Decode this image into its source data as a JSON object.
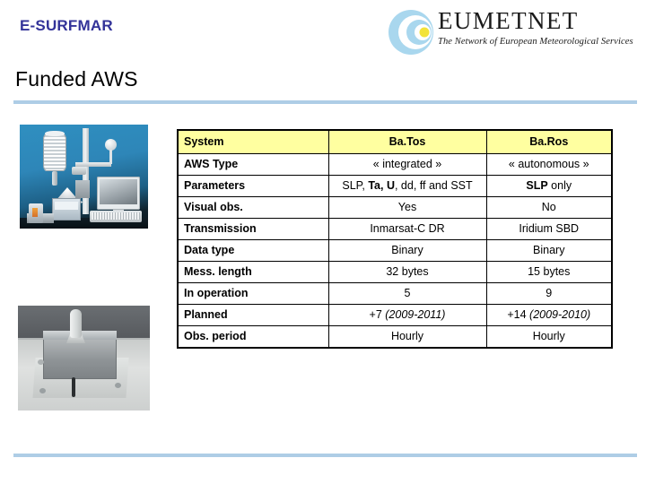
{
  "header": {
    "brand": "E-SURFMAR",
    "logo": {
      "word": "EUMETNET",
      "tagline": "The Network of European Meteorological Services",
      "mark": "eumetnet-circle-logo"
    }
  },
  "slide": {
    "title": "Funded AWS"
  },
  "photos": [
    {
      "name": "aws-station-photo",
      "caption": "BaTos integrated automatic weather station equipment"
    },
    {
      "name": "baros-unit-photo",
      "caption": "BaRos autonomous barometer unit mounted on deck"
    }
  ],
  "table": {
    "columns": [
      "System",
      "Ba.Tos",
      "Ba.Ros"
    ],
    "rows": [
      {
        "label": "AWS Type",
        "batos": "« integrated »",
        "baros": "« autonomous »"
      },
      {
        "label": "Parameters",
        "batos_line1_a": "SLP, ",
        "batos_line1_b": "Ta, U",
        "batos_line1_c": ", dd, ff",
        "batos_line2": "and SST",
        "baros_a": "SLP",
        "baros_b": " only"
      },
      {
        "label": "Visual obs.",
        "batos": "Yes",
        "baros": "No"
      },
      {
        "label": "Transmission",
        "batos": "Inmarsat-C DR",
        "baros": "Iridium SBD"
      },
      {
        "label": "Data type",
        "batos": "Binary",
        "baros": "Binary"
      },
      {
        "label": "Mess. length",
        "batos": "32 bytes",
        "baros": "15 bytes"
      },
      {
        "label": "In operation",
        "batos": "5",
        "baros": "9"
      },
      {
        "label": "Planned",
        "batos_num": "+7 ",
        "batos_years": "(2009-2011)",
        "baros_num": "+14 ",
        "baros_years": "(2009-2010)"
      },
      {
        "label": "Obs. period",
        "batos": "Hourly",
        "baros": "Hourly"
      }
    ]
  },
  "colors": {
    "brand_blue": "#333399",
    "rule_blue": "#aecde6",
    "header_yellow": "#ffffa0"
  }
}
